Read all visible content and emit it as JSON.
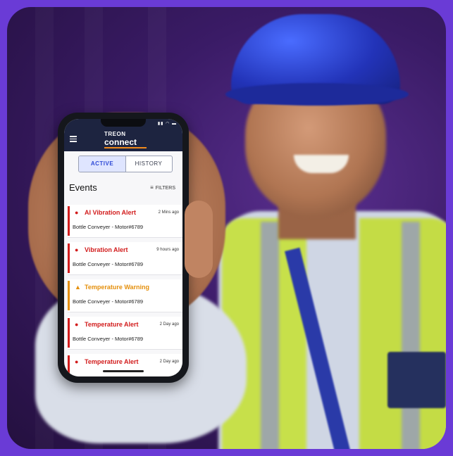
{
  "colors": {
    "frame": "#6a3bd6",
    "app_header": "#1d2440",
    "alert_red": "#d21c1c",
    "warning_orange": "#e5900d",
    "active_tab": "#2f4ad6"
  },
  "app": {
    "brand_top": "TREON",
    "brand_main": "connect"
  },
  "tabs": [
    {
      "label": "ACTIVE",
      "selected": true
    },
    {
      "label": "HISTORY",
      "selected": false
    }
  ],
  "events": {
    "title": "Events",
    "filters_label": "FILTERS",
    "items": [
      {
        "icon": "alert-circle-icon",
        "severity": "alert",
        "title": "AI Vibration Alert",
        "time": "2 Mins ago",
        "source": "Bottle Conveyer - Motor#6789"
      },
      {
        "icon": "alert-circle-icon",
        "severity": "alert",
        "title": "Vibration Alert",
        "time": "9 hours ago",
        "source": "Bottle Conveyer - Motor#6789"
      },
      {
        "icon": "warning-triangle-icon",
        "severity": "warning",
        "title": "Temperature Warning",
        "time": "",
        "source": "Bottle Conveyer - Motor#6789"
      },
      {
        "icon": "alert-circle-icon",
        "severity": "alert",
        "title": "Temperature Alert",
        "time": "2 Day ago",
        "source": "Bottle Conveyer - Motor#6789"
      },
      {
        "icon": "alert-circle-icon",
        "severity": "alert",
        "title": "Temperature Alert",
        "time": "2 Day ago",
        "source": ""
      }
    ]
  }
}
